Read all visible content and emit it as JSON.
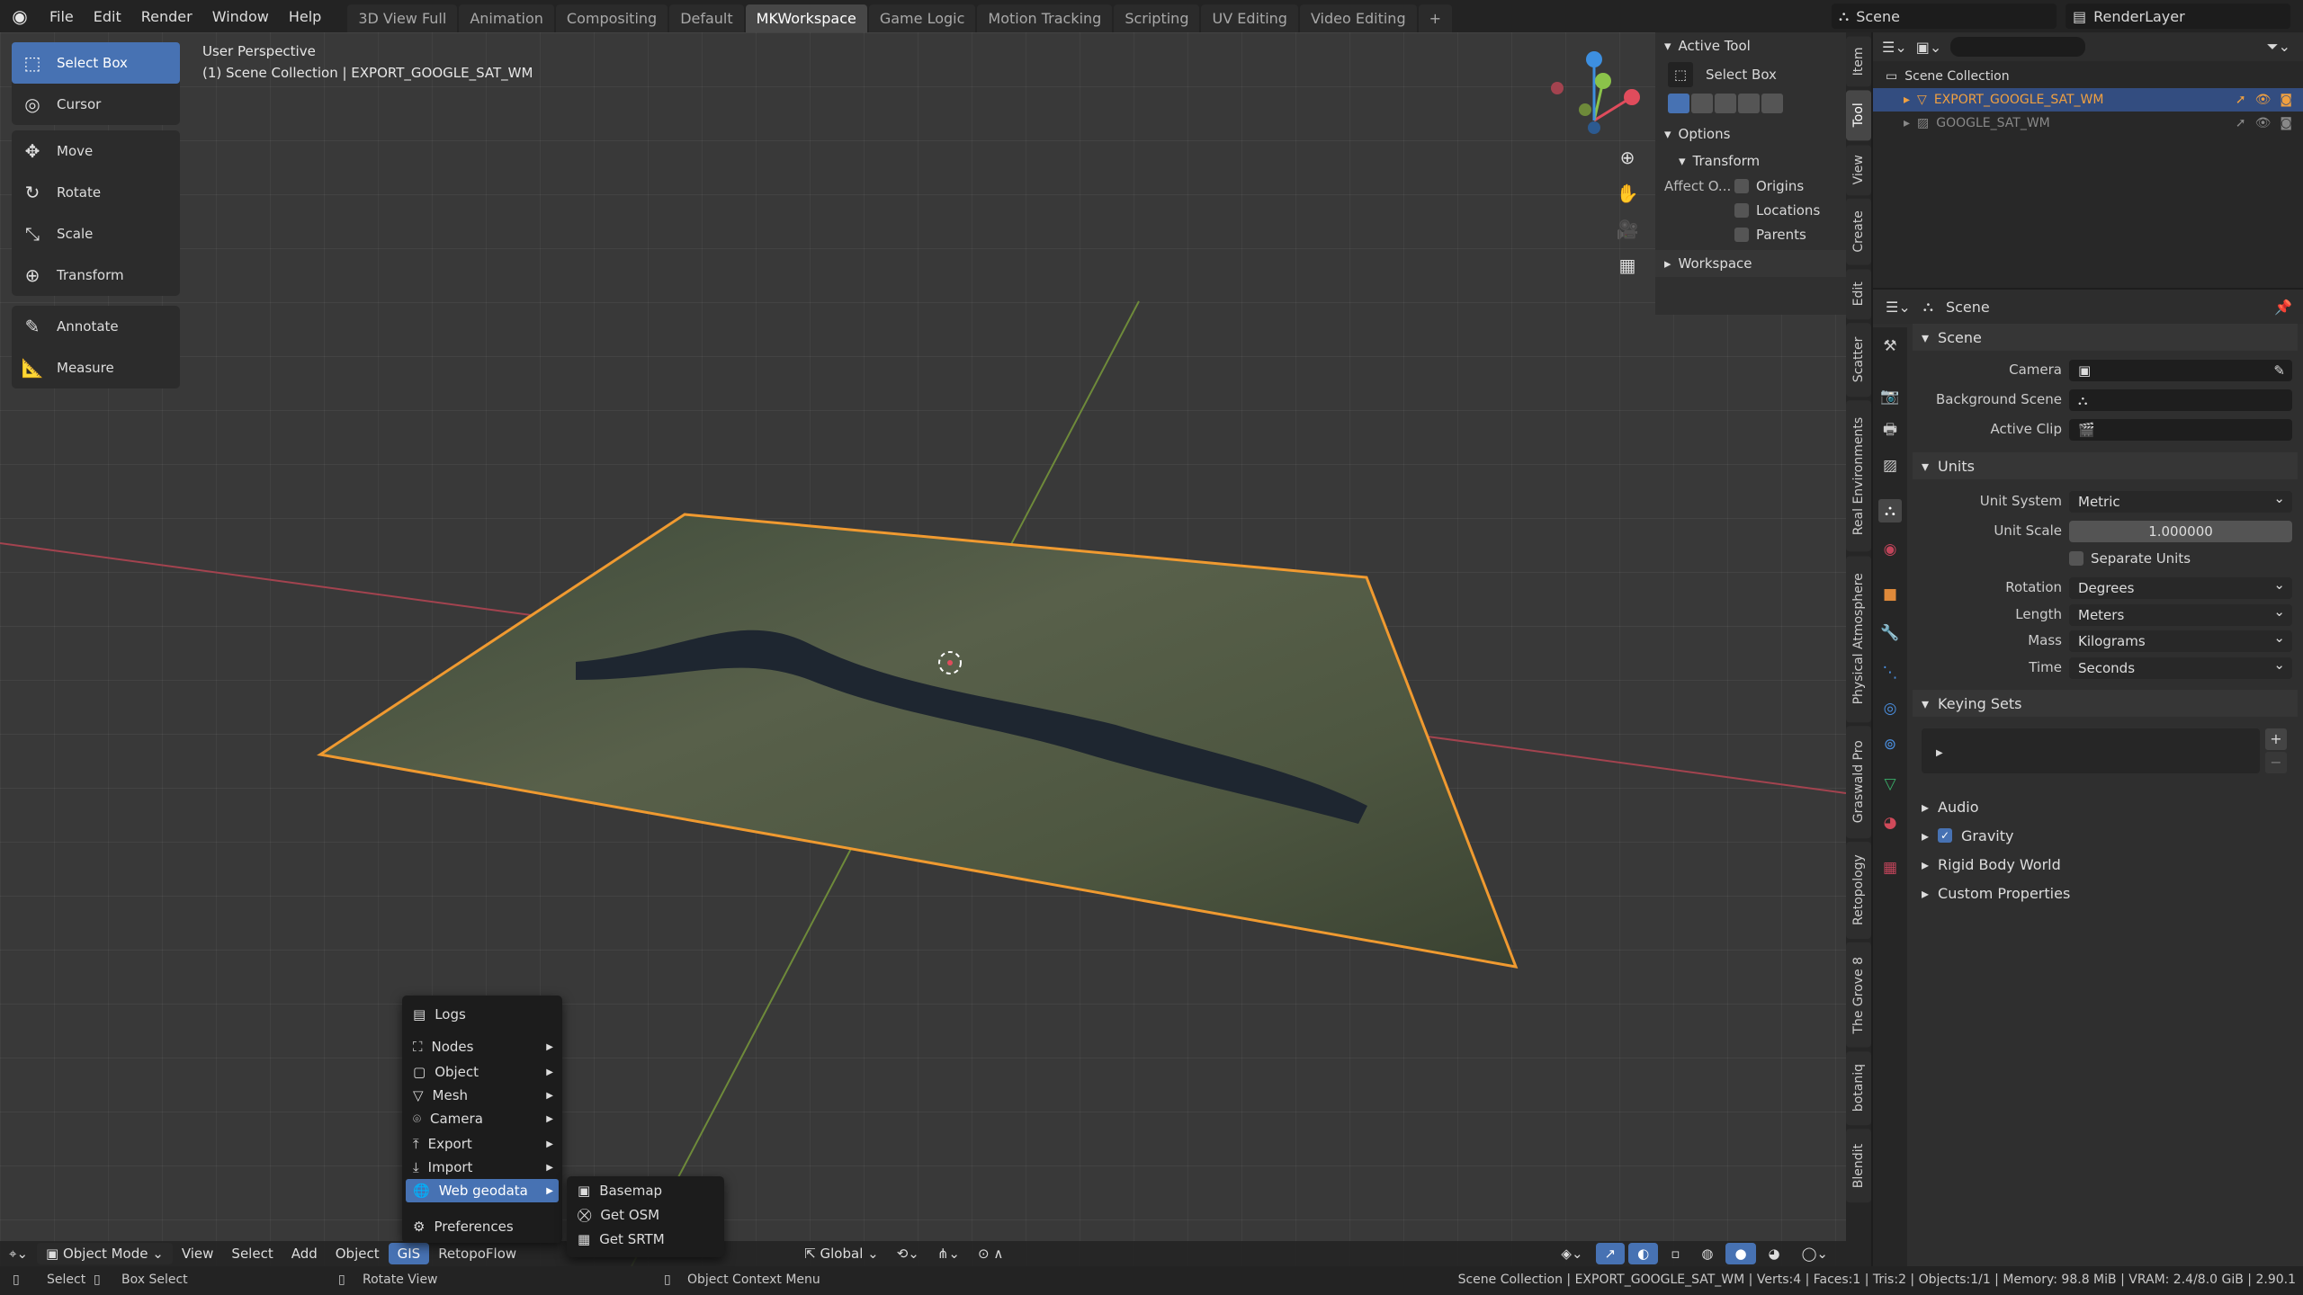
{
  "topbar": {
    "menus": [
      "File",
      "Edit",
      "Render",
      "Window",
      "Help"
    ],
    "workspaces": [
      "3D View Full",
      "Animation",
      "Compositing",
      "Default",
      "MKWorkspace",
      "Game Logic",
      "Motion Tracking",
      "Scripting",
      "UV Editing",
      "Video Editing",
      "+"
    ],
    "active_workspace": "MKWorkspace",
    "scene": "Scene",
    "view_layer": "RenderLayer"
  },
  "viewport": {
    "perspective": "User Perspective",
    "collection_info": "(1) Scene Collection | EXPORT_GOOGLE_SAT_WM",
    "tools": [
      {
        "label": "Select Box",
        "icon": "select-box-icon",
        "glyph": "⬚",
        "active": true
      },
      {
        "label": "Cursor",
        "icon": "cursor-icon",
        "glyph": "◎"
      },
      {
        "label": "Move",
        "icon": "move-icon",
        "glyph": "✥"
      },
      {
        "label": "Rotate",
        "icon": "rotate-icon",
        "glyph": "↻"
      },
      {
        "label": "Scale",
        "icon": "scale-icon",
        "glyph": "⤡"
      },
      {
        "label": "Transform",
        "icon": "transform-icon",
        "glyph": "⊕"
      },
      {
        "label": "Annotate",
        "icon": "annotate-icon",
        "glyph": "✎"
      },
      {
        "label": "Measure",
        "icon": "measure-icon",
        "glyph": "📐"
      }
    ],
    "gizmo_axes": {
      "x": "X",
      "y": "Y",
      "z": "Z"
    },
    "colors": {
      "x_axis": "#e04c5c",
      "y_axis": "#8bc34a",
      "z_axis": "#3d8fe0",
      "selection": "#f09a30"
    }
  },
  "npanel": {
    "active_tool_header": "Active Tool",
    "tool_name": "Select Box",
    "options_header": "Options",
    "transform_header": "Transform",
    "affect_label": "Affect O...",
    "affect": [
      {
        "label": "Origins",
        "checked": false
      },
      {
        "label": "Locations",
        "checked": false
      },
      {
        "label": "Parents",
        "checked": false
      }
    ],
    "workspace_header": "Workspace"
  },
  "side_tabs": [
    "Item",
    "Tool",
    "View",
    "Create",
    "Edit",
    "Scatter",
    "Real Environments",
    "Physical Atmosphere",
    "Graswald Pro",
    "Retopology",
    "The Grove 8",
    "botaniq",
    "Blendit"
  ],
  "active_side_tab": "Tool",
  "outliner": {
    "search_placeholder": "",
    "rows": [
      {
        "label": "Scene Collection",
        "icon": "collection-icon",
        "selected": false,
        "indent": 0
      },
      {
        "label": "EXPORT_GOOGLE_SAT_WM",
        "icon": "mesh-icon",
        "selected": true,
        "indent": 1
      },
      {
        "label": "GOOGLE_SAT_WM",
        "icon": "image-icon",
        "selected": false,
        "indent": 1,
        "dim": true
      }
    ]
  },
  "properties": {
    "context": "Scene",
    "scene_header": "Scene",
    "camera_label": "Camera",
    "background_scene_label": "Background Scene",
    "active_clip_label": "Active Clip",
    "units_header": "Units",
    "unit_system_label": "Unit System",
    "unit_system": "Metric",
    "unit_scale_label": "Unit Scale",
    "unit_scale": "1.000000",
    "separate_units_label": "Separate Units",
    "separate_units": false,
    "rotation_label": "Rotation",
    "rotation": "Degrees",
    "length_label": "Length",
    "length": "Meters",
    "mass_label": "Mass",
    "mass": "Kilograms",
    "time_label": "Time",
    "time": "Seconds",
    "keying_sets_header": "Keying Sets",
    "audio_header": "Audio",
    "gravity_header": "Gravity",
    "gravity": true,
    "rigid_body_header": "Rigid Body World",
    "custom_props_header": "Custom Properties"
  },
  "bottom_header": {
    "mode": "Object Mode",
    "menus": [
      "View",
      "Select",
      "Add",
      "Object",
      "GIS",
      "RetopoFlow"
    ],
    "active_menu": "GIS",
    "orientation": "Global"
  },
  "gis_menu": {
    "items": [
      {
        "label": "Logs",
        "icon": "logs-icon",
        "glyph": "▤",
        "sub": false
      },
      {
        "label": "Nodes",
        "icon": "nodes-icon",
        "glyph": "⛶",
        "sub": true
      },
      {
        "label": "Object",
        "icon": "object-icon",
        "glyph": "▢",
        "sub": true
      },
      {
        "label": "Mesh",
        "icon": "mesh-icon",
        "glyph": "▽",
        "sub": true
      },
      {
        "label": "Camera",
        "icon": "camera-icon",
        "glyph": "⌾",
        "sub": true
      },
      {
        "label": "Export",
        "icon": "export-icon",
        "glyph": "⤒",
        "sub": true
      },
      {
        "label": "Import",
        "icon": "import-icon",
        "glyph": "⤓",
        "sub": true
      },
      {
        "label": "Web geodata",
        "icon": "globe-icon",
        "glyph": "🌐",
        "sub": true,
        "highlighted": true
      },
      {
        "label": "Preferences",
        "icon": "gear-icon",
        "glyph": "⚙",
        "sub": false
      }
    ],
    "submenu": [
      {
        "label": "Basemap",
        "icon": "basemap-icon",
        "glyph": "▣"
      },
      {
        "label": "Get OSM",
        "icon": "osm-icon",
        "glyph": "⛒"
      },
      {
        "label": "Get SRTM",
        "icon": "srtm-icon",
        "glyph": "▦"
      }
    ]
  },
  "status": {
    "select": "Select",
    "box_select": "Box Select",
    "rotate_view": "Rotate View",
    "context_menu": "Object Context Menu",
    "stats": "Scene Collection | EXPORT_GOOGLE_SAT_WM | Verts:4 | Faces:1 | Tris:2 | Objects:1/1 | Memory: 98.8 MiB | VRAM: 2.4/8.0 GiB | 2.90.1"
  }
}
